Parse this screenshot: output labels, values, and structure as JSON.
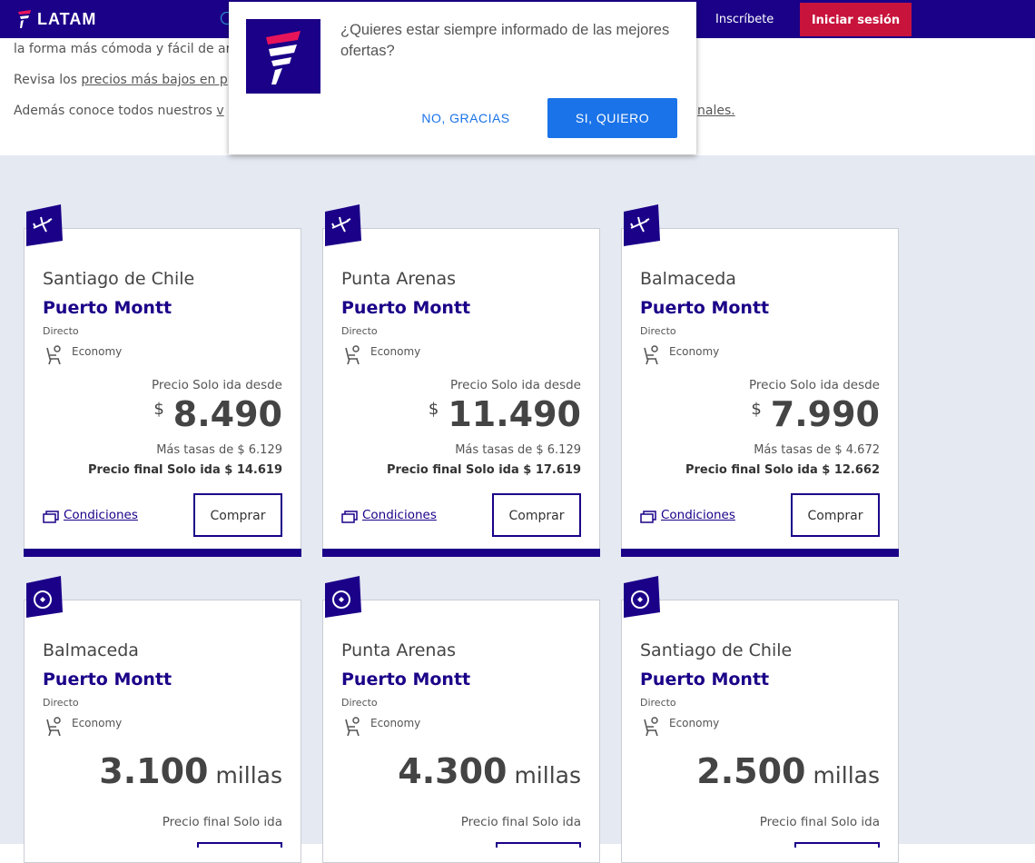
{
  "nav": {
    "logo_text": "LATAM",
    "signup_label": "Inscríbete",
    "login_label": "Iniciar sesión"
  },
  "intro": {
    "line1": "la forma más cómoda y fácil de ar",
    "line2_prefix": "Revisa los ",
    "line2_link": "precios más bajos en p",
    "line3_prefix": "Además conoce todos nuestros ",
    "line3_link": "v",
    "line3_tail": "nales."
  },
  "popup": {
    "message": "¿Quieres estar siempre informado de las mejores ofertas?",
    "no_label": "NO, GRACIAS",
    "yes_label": "SI, QUIERO"
  },
  "price_cards": [
    {
      "origin": "Santiago de Chile",
      "destination": "Puerto Montt",
      "stops": "Directo",
      "cabin": "Economy",
      "price_label": "Precio Solo ida desde",
      "currency": "$",
      "price": "8.490",
      "taxes": "Más tasas de $ 6.129",
      "final": "Precio final Solo ida $ 14.619",
      "conditions": "Condiciones",
      "buy": "Comprar"
    },
    {
      "origin": "Punta Arenas",
      "destination": "Puerto Montt",
      "stops": "Directo",
      "cabin": "Economy",
      "price_label": "Precio Solo ida desde",
      "currency": "$",
      "price": "11.490",
      "taxes": "Más tasas de $ 6.129",
      "final": "Precio final Solo ida $ 17.619",
      "conditions": "Condiciones",
      "buy": "Comprar"
    },
    {
      "origin": "Balmaceda",
      "destination": "Puerto Montt",
      "stops": "Directo",
      "cabin": "Economy",
      "price_label": "Precio Solo ida desde",
      "currency": "$",
      "price": "7.990",
      "taxes": "Más tasas de $ 4.672",
      "final": "Precio final Solo ida $ 12.662",
      "conditions": "Condiciones",
      "buy": "Comprar"
    }
  ],
  "miles_cards": [
    {
      "origin": "Balmaceda",
      "destination": "Puerto Montt",
      "stops": "Directo",
      "cabin": "Economy",
      "amount": "3.100",
      "unit": "millas",
      "final": "Precio final Solo ida"
    },
    {
      "origin": "Punta Arenas",
      "destination": "Puerto Montt",
      "stops": "Directo",
      "cabin": "Economy",
      "amount": "4.300",
      "unit": "millas",
      "final": "Precio final Solo ida"
    },
    {
      "origin": "Santiago de Chile",
      "destination": "Puerto Montt",
      "stops": "Directo",
      "cabin": "Economy",
      "amount": "2.500",
      "unit": "millas",
      "final": "Precio final Solo ida"
    }
  ],
  "icons": {
    "price_tag": "airplane-icon",
    "miles_tag": "miles-icon",
    "seat": "seat-icon",
    "conditions": "document-icon"
  },
  "colors": {
    "brand": "#1b0088",
    "login": "#c8143c",
    "popup_button": "#1a73e8",
    "page_bg": "#e5e9f2"
  }
}
